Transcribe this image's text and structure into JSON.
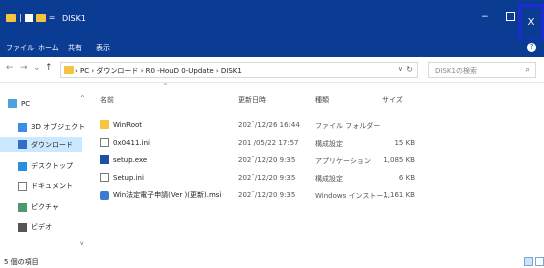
{
  "window": {
    "title": "DISK1",
    "minimize_glyph": "−",
    "close_glyph": "X"
  },
  "ribbon": {
    "tabs": [
      "ファイル",
      "ホーム",
      "共有",
      "表示"
    ],
    "help_glyph": "?"
  },
  "address": {
    "back_glyph": "←",
    "forward_glyph": "→",
    "recent_glyph": "⌄",
    "up_glyph": "↑",
    "crumbs": "› PC › ダウンロード › R0 -HouD  0-Update › DISK1",
    "dropdown_glyph": "∨",
    "refresh_glyph": "↻",
    "search_placeholder": "DISK1の検索",
    "search_glyph": "⌕"
  },
  "sidebar": {
    "items": [
      {
        "label": "PC",
        "icon": "pc-icon",
        "color": "#4aa3df"
      },
      {
        "label": "3D オブジェクト",
        "icon": "cube-icon",
        "color": "#3a8ee6"
      },
      {
        "label": "ダウンロード",
        "icon": "download-icon",
        "color": "#2f6fc6"
      },
      {
        "label": "デスクトップ",
        "icon": "desktop-icon",
        "color": "#2b8fe0"
      },
      {
        "label": "ドキュメント",
        "icon": "document-icon",
        "color": "#7a7a7a"
      },
      {
        "label": "ピクチャ",
        "icon": "pictures-icon",
        "color": "#4a9a6e"
      },
      {
        "label": "ビデオ",
        "icon": "video-icon",
        "color": "#555555"
      }
    ],
    "scroll_up_glyph": "^",
    "scroll_down_glyph": "v"
  },
  "table": {
    "columns": {
      "name": "名前",
      "date": "更新日時",
      "type": "種類",
      "size": "サイズ"
    },
    "sort_glyph": "^",
    "rows": [
      {
        "name": "WinRoot",
        "date": "202ˉ/12/26 16:44",
        "type": "ファイル フォルダー",
        "size": "",
        "icon": "folder"
      },
      {
        "name": "0x0411.ini",
        "date": "201 /05/22 17:57",
        "type": "構成設定",
        "size": "15 KB",
        "icon": "ini"
      },
      {
        "name": "setup.exe",
        "date": "202ˉ/12/20 9:35",
        "type": "アプリケーション",
        "size": "1,085 KB",
        "icon": "exe"
      },
      {
        "name": "Setup.ini",
        "date": "202ˉ/12/20 9:35",
        "type": "構成設定",
        "size": "6 KB",
        "icon": "ini"
      },
      {
        "name": "Win法定電子申請(Ver        )(更新).msi",
        "date": "202ˉ/12/20 9:35",
        "type": "Windows インストー...",
        "size": "1,161 KB",
        "icon": "msi"
      }
    ]
  },
  "status": {
    "count": "5 個の項目"
  }
}
